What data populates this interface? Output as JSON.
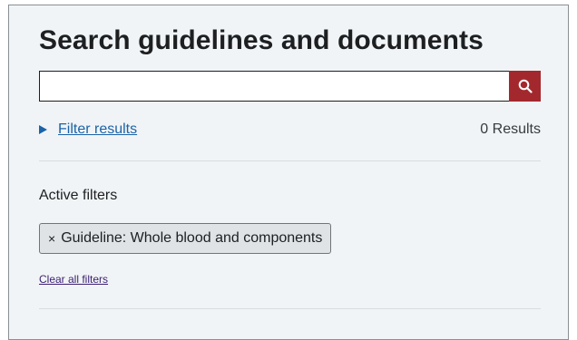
{
  "title": "Search guidelines and documents",
  "search": {
    "value": "",
    "placeholder": "",
    "button_icon": "search-icon"
  },
  "filter": {
    "toggle_label": "Filter results",
    "toggle_icon": "triangle-right-icon",
    "results_count": "0 Results"
  },
  "active_filters": {
    "label": "Active filters",
    "chips": [
      {
        "remove_symbol": "×",
        "label": "Guideline: Whole blood and components"
      }
    ],
    "clear_label": "Clear all filters"
  },
  "colors": {
    "panel_background": "#f1f4f6",
    "search_button": "#a3282d",
    "link": "#1b63a8",
    "visited_link": "#3b1f73",
    "chip_background": "#dfe3e6"
  }
}
